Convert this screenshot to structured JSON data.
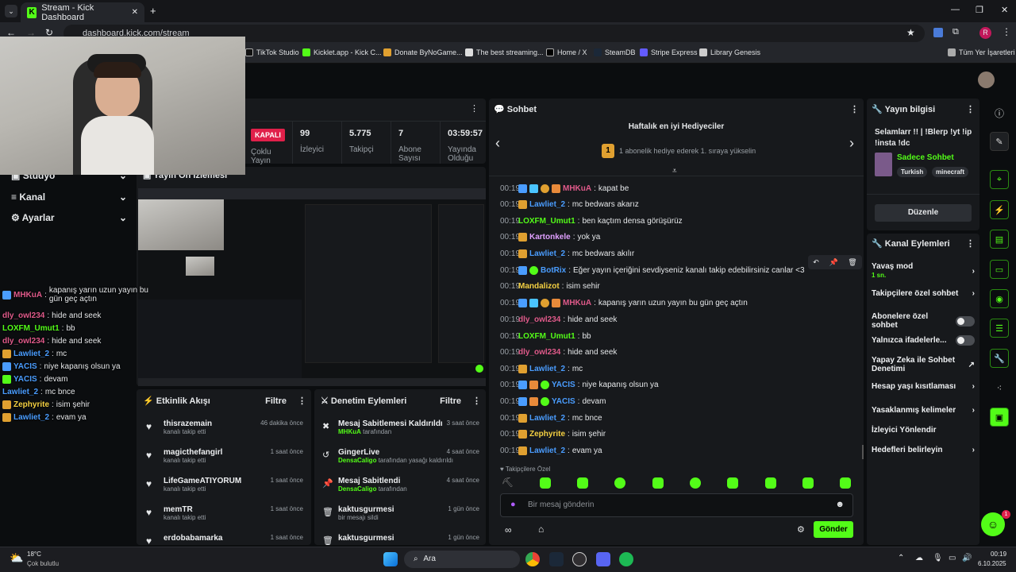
{
  "browser": {
    "tab_title": "Stream - Kick Dashboard",
    "url": "dashboard.kick.com/stream",
    "bookmarks": [
      "TikTok Studio",
      "Kicklet.app - Kick C...",
      "Donate ByNoGame...",
      "The best streaming...",
      "Home / X",
      "SteamDB",
      "Stripe Express",
      "Library Genesis"
    ],
    "bookmarks_right": "Tüm Yer İşaretleri",
    "profile_letter": "R"
  },
  "stats": {
    "status_badge": "KAPALI",
    "status_label": "Çoklu Yayın",
    "viewers_value": "99",
    "viewers_label": "İzleyici",
    "followers_value": "5.775",
    "followers_label": "Takipçi",
    "subs_value": "7",
    "subs_label": "Abone Sayısı",
    "uptime_value": "03:59:57",
    "uptime_label": "Yayında Olduğu"
  },
  "sidebar": {
    "items": [
      {
        "label": "Stüdyo"
      },
      {
        "label": "Kanal"
      },
      {
        "label": "Ayarlar"
      }
    ]
  },
  "preview": {
    "title": "Yayın Ön İzlemesi"
  },
  "overlay_chat": [
    {
      "user": "MHKuA",
      "text": "kapanış yarın uzun yayın bu gün geç açtın",
      "color": "#e05a8a"
    },
    {
      "user": "dly_owl234",
      "text": "hide and seek",
      "color": "#e05a8a"
    },
    {
      "user": "LOXFM_Umut1",
      "text": "bb",
      "color": "#53fc18"
    },
    {
      "user": "dly_owl234",
      "text": "hide and seek",
      "color": "#e05a8a"
    },
    {
      "user": "Lawliet_2",
      "text": "mc",
      "color": "#4a9dff"
    },
    {
      "user": "YACIS",
      "text": "niye kapanış olsun ya",
      "color": "#4a9dff"
    },
    {
      "user": "YACIS",
      "text": "devam",
      "color": "#4a9dff"
    },
    {
      "user": "Lawliet_2",
      "text": "mc bnce",
      "color": "#4a9dff"
    },
    {
      "user": "Zephyrite",
      "text": "isim şehir",
      "color": "#f5d142"
    },
    {
      "user": "Lawliet_2",
      "text": "evam ya",
      "color": "#4a9dff"
    }
  ],
  "activity": {
    "title": "Etkinlik Akışı",
    "filter_label": "Filtre",
    "items": [
      {
        "name": "thisrazemain",
        "sub": "kanalı takip etti",
        "time": "46 dakika önce"
      },
      {
        "name": "magicthefangirl",
        "sub": "kanalı takip etti",
        "time": "1 saat önce"
      },
      {
        "name": "LifeGameATIYORUM",
        "sub": "kanalı takip etti",
        "time": "1 saat önce"
      },
      {
        "name": "memTR",
        "sub": "kanalı takip etti",
        "time": "1 saat önce"
      },
      {
        "name": "erdobabamarka",
        "sub": "",
        "time": "1 saat önce"
      }
    ]
  },
  "moderation": {
    "title": "Denetim Eylemleri",
    "filter_label": "Filtre",
    "items": [
      {
        "action": "Mesaj Sabitlemesi Kaldırıldı",
        "actor": "MHKuA",
        "rest": "tarafından",
        "time": "3 saat önce"
      },
      {
        "action": "GingerLive",
        "actor": "DensaCaligo",
        "rest": "tarafından yasağı kaldırıldı",
        "time": "4 saat önce"
      },
      {
        "action": "Mesaj Sabitlendi",
        "actor": "DensaCaligo",
        "rest": "tarafından",
        "time": "4 saat önce"
      },
      {
        "action": "kaktusgurmesi",
        "actor": "",
        "rest": "bir mesajı sildi",
        "time": "1 gün önce"
      },
      {
        "action": "kaktusgurmesi",
        "actor": "",
        "rest": "",
        "time": "1 gün önce"
      }
    ]
  },
  "chat": {
    "title": "Sohbet",
    "gifter_title": "Haftalık en iyi Hediyeciler",
    "gifter_rank": "1",
    "gifter_text": "1 abonelik hediye ederek 1. sıraya yükselin",
    "messages": [
      {
        "time": "00:19",
        "user": "MHKuA",
        "text": "kapat be",
        "color": "#e05a8a"
      },
      {
        "time": "00:19",
        "user": "Lawliet_2",
        "text": "mc bedwars akarız",
        "color": "#4a9dff"
      },
      {
        "time": "00:19",
        "user": "LOXFM_Umut1",
        "text": "ben kaçtım densa görüşürüz",
        "color": "#53fc18"
      },
      {
        "time": "00:19",
        "user": "Kartonkele",
        "text": "yok ya",
        "color": "#e0a0ff"
      },
      {
        "time": "00:19",
        "user": "Lawliet_2",
        "text": "mc bedwars akılır",
        "color": "#4a9dff"
      },
      {
        "time": "00:19",
        "user": "BotRix",
        "text": "Eğer yayın içeriğini sevdiyseniz kanalı takip edebilirsiniz canlar <3",
        "color": "#4a9dff"
      },
      {
        "time": "00:19",
        "user": "Mandalizot",
        "text": "isim sehir",
        "color": "#f5d142"
      },
      {
        "time": "00:19",
        "user": "MHKuA",
        "text": "kapanış yarın uzun yayın bu gün geç açtın",
        "color": "#e05a8a"
      },
      {
        "time": "00:19",
        "user": "dly_owl234",
        "text": "hide and seek",
        "color": "#e05a8a"
      },
      {
        "time": "00:19",
        "user": "LOXFM_Umut1",
        "text": "bb",
        "color": "#53fc18"
      },
      {
        "time": "00:19",
        "user": "dly_owl234",
        "text": "hide and seek",
        "color": "#e05a8a"
      },
      {
        "time": "00:19",
        "user": "Lawliet_2",
        "text": "mc",
        "color": "#4a9dff"
      },
      {
        "time": "00:19",
        "user": "YACIS",
        "text": "niye kapanış olsun ya",
        "color": "#4a9dff"
      },
      {
        "time": "00:19",
        "user": "YACIS",
        "text": "devam",
        "color": "#4a9dff"
      },
      {
        "time": "00:19",
        "user": "Lawliet_2",
        "text": "mc bnce",
        "color": "#4a9dff"
      },
      {
        "time": "00:19",
        "user": "Zephyrite",
        "text": "isim şehir",
        "color": "#f5d142"
      },
      {
        "time": "00:19",
        "user": "Lawliet_2",
        "text": "evam ya",
        "color": "#4a9dff"
      }
    ],
    "followers_only": "Takipçilere Özel",
    "input_placeholder": "Bir mesaj gönderin",
    "send_label": "Gönder"
  },
  "stream_info": {
    "title": "Yayın bilgisi",
    "stream_title": "Selamlarr !! | !Blerp !yt !ip !insta !dc",
    "category": "Sadece Sohbet",
    "tags": [
      "Turkish",
      "minecraft"
    ],
    "edit_label": "Düzenle"
  },
  "channel_actions": {
    "title": "Kanal Eylemleri",
    "slow_mode": "Yavaş mod",
    "slow_mode_value": "1 sn.",
    "followers_chat": "Takipçilere özel sohbet",
    "subs_chat": "Abonelere özel sohbet",
    "emotes_only": "Yalnızca ifadelerle...",
    "ai_moderation": "Yapay Zeka ile Sohbet Denetimi",
    "account_age": "Hesap yaşı kısıtlaması",
    "banned_words": "Yasaklanmış kelimeler",
    "raid": "İzleyici Yönlendir",
    "goals": "Hedefleri belirleyin"
  },
  "help_badge": "1",
  "taskbar": {
    "weather_temp": "18°C",
    "weather_desc": "Çok bulutlu",
    "search_label": "Ara",
    "time": "00:19",
    "date": "6.10.2025"
  }
}
